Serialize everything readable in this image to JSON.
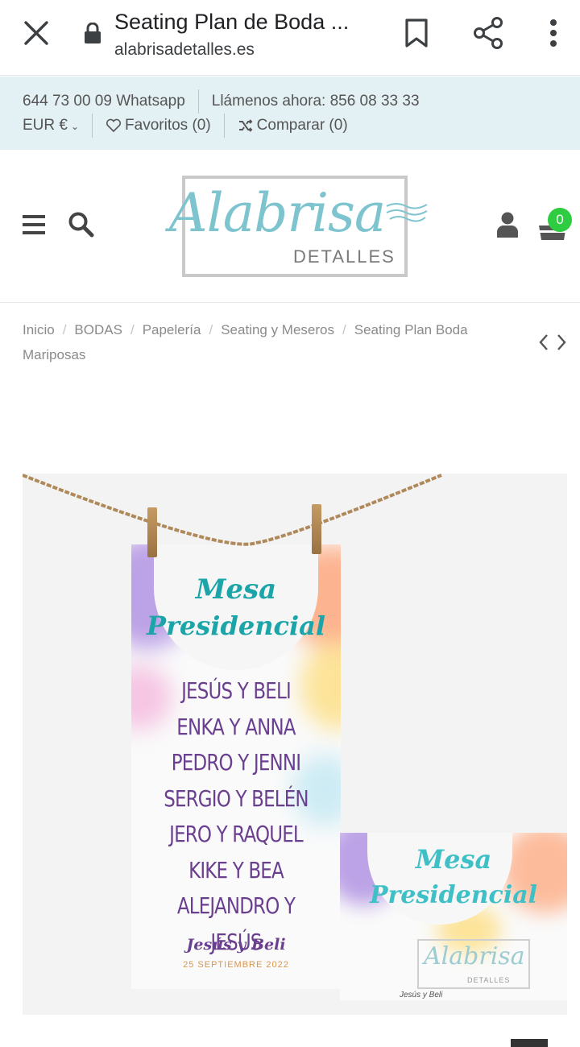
{
  "browser": {
    "page_title": "Seating Plan de Boda ...",
    "url": "alabrisadetalles.es"
  },
  "topbar": {
    "phone_whatsapp": "644 73 00 09 Whatsapp",
    "call_text": "Llámenos ahora: 856 08 33 33",
    "currency": "EUR €",
    "favorites": "Favoritos (0)",
    "compare": "Comparar (0)"
  },
  "header": {
    "logo_script": "Alabrisa",
    "logo_sub": "DETALLES",
    "cart_count": "0"
  },
  "breadcrumb": {
    "items": [
      "Inicio",
      "BODAS",
      "Papelería",
      "Seating y Meseros",
      "Seating Plan Boda Mariposas"
    ]
  },
  "product_image": {
    "card_title_1": "Mesa",
    "card_title_2": "Presidencial",
    "names": [
      "JESÚS Y BELI",
      "ENKA Y ANNA",
      "PEDRO Y JENNI",
      "SERGIO Y BELÉN",
      "JERO Y RAQUEL",
      "KIKE Y BEA",
      "ALEJANDRO Y JESÚS"
    ],
    "signature": "Jesús y Beli",
    "date": "25 SEPTIEMBRE 2022",
    "small_card_title_1": "Mesa",
    "small_card_title_2": "Presidencial",
    "small_logo": "Alabrisa",
    "small_logo_sub": "DETALLES",
    "small_signature": "Jesús y Beli"
  },
  "colors": {
    "topbar_bg": "#e3f0f4",
    "logo_teal": "#7ec4cf",
    "card_teal": "#1ba5a9",
    "names_purple": "#6a3f8f",
    "badge_green": "#2ecc40"
  }
}
